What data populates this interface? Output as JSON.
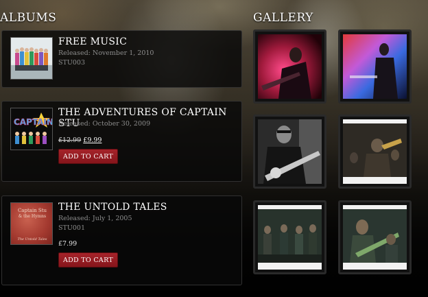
{
  "sections": {
    "albums_title": "ALBUMS",
    "gallery_title": "GALLERY"
  },
  "albums": [
    {
      "title": "FREE MUSIC",
      "released": "Released: November 1, 2010",
      "code": "STU003"
    },
    {
      "title": "THE ADVENTURES OF CAPTAIN STU",
      "released": "Released: October 30, 2009",
      "old_price": "£12.99",
      "new_price": "£9.99",
      "cart_label": "ADD TO CART",
      "cover_text": "CAPTAIN STU"
    },
    {
      "title": "THE UNTOLD TALES",
      "released": "Released: July 1, 2005",
      "code": "STU001",
      "price": "£7.99",
      "cart_label": "ADD TO CART",
      "cover_text_1": "Captain Stu",
      "cover_text_2": "& the Hymns",
      "cover_text_3": "The Untold Tales"
    }
  ],
  "gallery": {
    "photos": [
      {
        "name": "gallery-photo-1"
      },
      {
        "name": "gallery-photo-2"
      },
      {
        "name": "gallery-photo-3"
      },
      {
        "name": "gallery-photo-4"
      },
      {
        "name": "gallery-photo-5"
      },
      {
        "name": "gallery-photo-6"
      }
    ]
  },
  "colors": {
    "cart_button": "#a6232a",
    "panel": "#080808",
    "meta_text": "#8d8d8d"
  }
}
